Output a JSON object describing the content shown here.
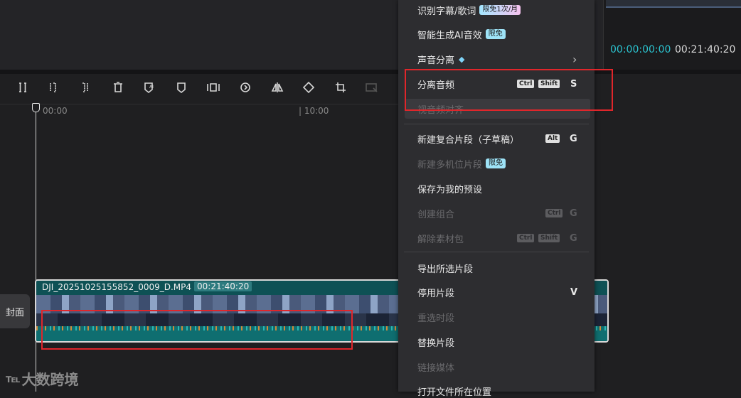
{
  "player": {
    "current_time": "00:00:00:00",
    "total_time": "00:21:40:20"
  },
  "toolbar": {
    "icons": [
      "split-icon",
      "split-left-icon",
      "split-right-icon",
      "delete-icon",
      "ai-marker-icon",
      "marker-icon",
      "freeze-icon",
      "reverse-icon",
      "mirror-icon",
      "rotate-icon",
      "crop-icon",
      "crop-disabled-icon"
    ]
  },
  "timeline": {
    "ruler_labels": [
      "00:00",
      "| 10:00"
    ],
    "cover_label": "封面",
    "clip": {
      "name": "DJI_20251025155852_0009_D.MP4",
      "duration": "00:21:40:20"
    }
  },
  "context_menu": {
    "items": [
      {
        "label": "识别字幕/歌词",
        "badge": "限免1次/月",
        "state": "normal"
      },
      {
        "label": "智能生成AI音效",
        "badge": "限免",
        "state": "normal"
      },
      {
        "label": "声音分离",
        "icon": "diamond-icon",
        "submenu": "›",
        "state": "normal"
      },
      {
        "label": "分离音频",
        "shortcut": [
          "Ctrl",
          "Shift",
          "S"
        ],
        "state": "normal"
      },
      {
        "label": "视音频对齐",
        "state": "disabled"
      },
      {
        "label": "新建复合片段（子草稿）",
        "shortcut": [
          "Alt",
          "G"
        ],
        "state": "normal"
      },
      {
        "label": "新建多机位片段",
        "badge": "限免",
        "state": "disabled"
      },
      {
        "label": "保存为我的预设",
        "state": "normal"
      },
      {
        "label": "创建组合",
        "shortcut": [
          "Ctrl",
          "G"
        ],
        "state": "disabled"
      },
      {
        "label": "解除素材包",
        "shortcut": [
          "Ctrl",
          "Shift",
          "G"
        ],
        "state": "disabled"
      },
      {
        "label": "导出所选片段",
        "state": "normal"
      },
      {
        "label": "停用片段",
        "shortcut": [
          "V"
        ],
        "state": "normal"
      },
      {
        "label": "重选时段",
        "state": "disabled"
      },
      {
        "label": "替换片段",
        "state": "normal"
      },
      {
        "label": "链接媒体",
        "state": "disabled"
      },
      {
        "label": "打开文件所在位置",
        "state": "normal"
      }
    ]
  },
  "watermark": {
    "text": "大数跨境"
  },
  "colors": {
    "accent": "#2bc3cf",
    "highlight": "#e0262b",
    "clip": "#0e5b5e"
  }
}
